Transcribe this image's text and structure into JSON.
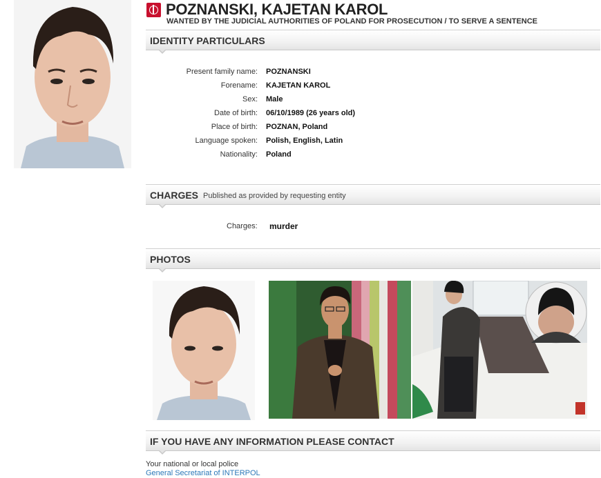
{
  "header": {
    "name": "POZNANSKI, KAJETAN KAROL",
    "wanted_text": "WANTED BY THE JUDICIAL AUTHORITIES OF POLAND FOR PROSECUTION / TO SERVE A SENTENCE",
    "badge_icon": "interpol-logo-icon"
  },
  "identity": {
    "title": "IDENTITY PARTICULARS",
    "rows": [
      {
        "label": "Present family name:",
        "value": "POZNANSKI"
      },
      {
        "label": "Forename:",
        "value": "KAJETAN KAROL"
      },
      {
        "label": "Sex:",
        "value": "Male"
      },
      {
        "label": "Date of birth:",
        "value": "06/10/1989 (26 years old)"
      },
      {
        "label": "Place of birth:",
        "value": "POZNAN, Poland"
      },
      {
        "label": "Language spoken:",
        "value": "Polish, English, Latin"
      },
      {
        "label": "Nationality:",
        "value": "Poland"
      }
    ]
  },
  "charges": {
    "title": "CHARGES",
    "subtitle": "Published as provided by requesting entity",
    "label": "Charges:",
    "value": "murder"
  },
  "photos": {
    "title": "PHOTOS"
  },
  "contact": {
    "title": "IF YOU HAVE ANY INFORMATION PLEASE CONTACT",
    "line1": "Your national or local police",
    "link": "General Secretariat of INTERPOL"
  },
  "colors": {
    "brand_red": "#c8102e",
    "link_blue": "#2b78b8"
  }
}
